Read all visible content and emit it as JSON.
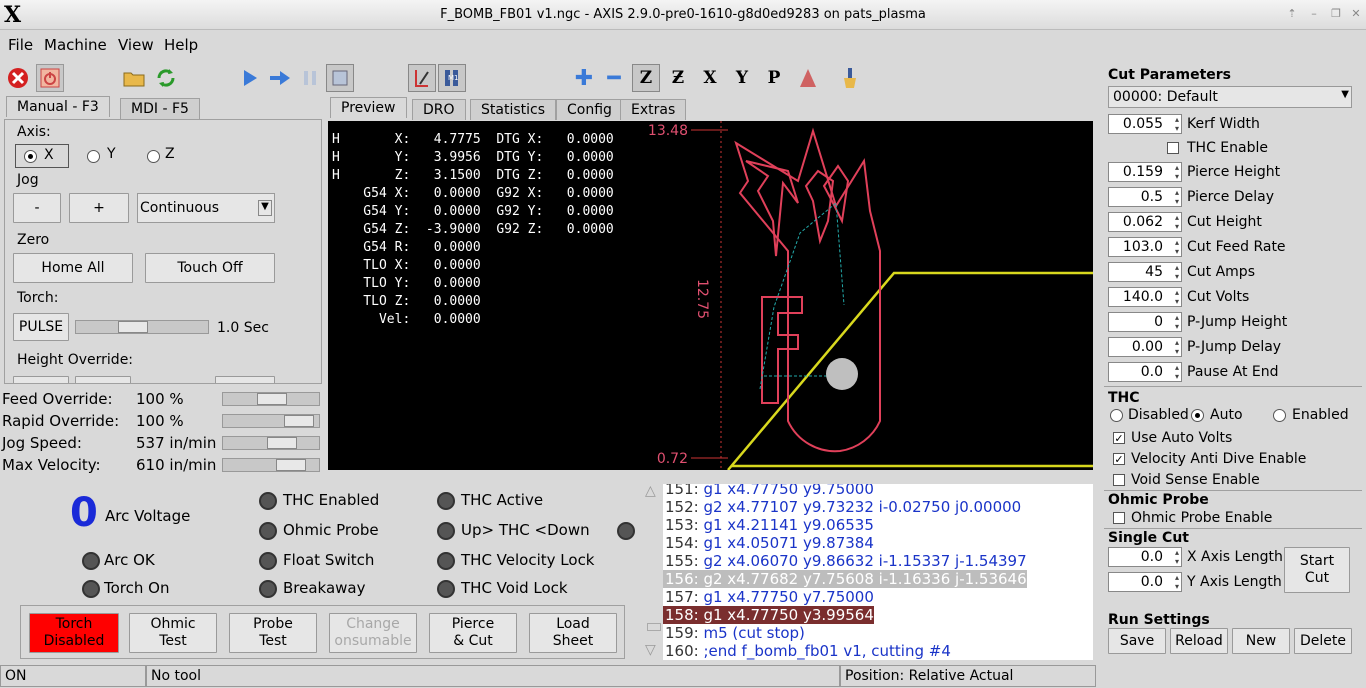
{
  "window": {
    "title": "F_BOMB_FB01 v1.ngc - AXIS 2.9.0-pre0-1610-g8d0ed9283 on pats_plasma",
    "logo": "X"
  },
  "menu": {
    "file": "File",
    "machine": "Machine",
    "view": "View",
    "help": "Help"
  },
  "left_tabs": {
    "manual": "Manual - F3",
    "mdi": "MDI - F5"
  },
  "manual": {
    "axis_label": "Axis:",
    "axis_x": "X",
    "axis_y": "Y",
    "axis_z": "Z",
    "jog_label": "Jog",
    "jog_minus": "-",
    "jog_plus": "+",
    "jog_mode": "Continuous",
    "zero_label": "Zero",
    "home_all": "Home All",
    "touch_off": "Touch Off",
    "torch_label": "Torch:",
    "pulse": "PULSE",
    "pulse_time": "1.0 Sec",
    "height_override": "Height Override:"
  },
  "overrides": [
    {
      "label": "Feed Override:",
      "value": "100 %",
      "level": 0.5
    },
    {
      "label": "Rapid Override:",
      "value": "100 %",
      "level": 0.9
    },
    {
      "label": "Jog Speed:",
      "value": "537 in/min",
      "level": 0.65
    },
    {
      "label": "Max Velocity:",
      "value": "610 in/min",
      "level": 0.78
    }
  ],
  "view_tabs": {
    "preview": "Preview",
    "dro": "DRO",
    "statistics": "Statistics",
    "config": "Config",
    "extras": "Extras"
  },
  "dro_lines": [
    "H       X:   4.7775  DTG X:   0.0000",
    "H       Y:   3.9956  DTG Y:   0.0000",
    "H       Z:   3.1500  DTG Z:   0.0000",
    "    G54 X:   0.0000  G92 X:   0.0000",
    "    G54 Y:   0.0000  G92 Y:   0.0000",
    "    G54 Z:  -3.9000  G92 Z:   0.0000",
    "    G54 R:   0.0000",
    "    TLO X:   0.0000",
    "    TLO Y:   0.0000",
    "    TLO Z:   0.0000",
    "      Vel:   0.0000"
  ],
  "preview": {
    "z_top": "13.48",
    "z_mid": "12.75",
    "z_bottom": "0.72"
  },
  "status": {
    "arc_voltage_value": "0",
    "arc_voltage": "Arc Voltage",
    "arc_ok": "Arc OK",
    "torch_on": "Torch On",
    "thc_enabled": "THC Enabled",
    "ohmic_probe": "Ohmic Probe",
    "float_switch": "Float Switch",
    "breakaway": "Breakaway",
    "thc_active": "THC Active",
    "up_down": "Up> THC <Down",
    "thc_velocity_lock": "THC Velocity Lock",
    "thc_void_lock": "THC Void Lock"
  },
  "buttons": {
    "torch_disabled": "Torch\nDisabled",
    "ohmic_test": "Ohmic\nTest",
    "probe_test": "Probe\nTest",
    "change_consumable": "Change\nonsumable",
    "pierce_cut": "Pierce\n& Cut",
    "load_sheet": "Load\nSheet"
  },
  "gcode": [
    {
      "n": "151:",
      "code": "g1 x4.77750 y9.75000",
      "hl": ""
    },
    {
      "n": "152:",
      "code": "g2 x4.77107 y9.73232 i-0.02750 j0.00000",
      "hl": ""
    },
    {
      "n": "153:",
      "code": "g1 x4.21141 y9.06535",
      "hl": ""
    },
    {
      "n": "154:",
      "code": "g1 x4.05071 y9.87384",
      "hl": ""
    },
    {
      "n": "155:",
      "code": "g2 x4.06070 y9.86632 i-1.15337 j-1.54397",
      "hl": ""
    },
    {
      "n": "156:",
      "code": "g2 x4.77682 y7.75608 i-1.16336 j-1.53646",
      "hl": "gray"
    },
    {
      "n": "157:",
      "code": "g1 x4.77750 y7.75000",
      "hl": ""
    },
    {
      "n": "158:",
      "code": "g1 x4.77750 y3.99564",
      "hl": "red"
    },
    {
      "n": "159:",
      "code": "m5 (cut stop)",
      "hl": ""
    },
    {
      "n": "160:",
      "code": ";end f_bomb_fb01 v1, cutting #4",
      "hl": ""
    }
  ],
  "cut_params": {
    "title": "Cut Parameters",
    "material": "00000: Default",
    "thc_enable": "THC Enable",
    "rows": [
      {
        "value": "0.055",
        "label": "Kerf Width"
      },
      {
        "value": "0.159",
        "label": "Pierce Height"
      },
      {
        "value": "0.5",
        "label": "Pierce Delay"
      },
      {
        "value": "0.062",
        "label": "Cut Height"
      },
      {
        "value": "103.0",
        "label": "Cut Feed Rate"
      },
      {
        "value": "45",
        "label": "Cut Amps"
      },
      {
        "value": "140.0",
        "label": "Cut Volts"
      },
      {
        "value": "0",
        "label": "P-Jump Height"
      },
      {
        "value": "0.00",
        "label": "P-Jump Delay"
      },
      {
        "value": "0.0",
        "label": "Pause At End"
      }
    ]
  },
  "thc": {
    "title": "THC",
    "disabled": "Disabled",
    "auto": "Auto",
    "enabled": "Enabled",
    "use_auto_volts": "Use Auto Volts",
    "velocity_anti_dive": "Velocity Anti Dive Enable",
    "void_sense": "Void Sense Enable"
  },
  "ohmic": {
    "title": "Ohmic Probe",
    "enable": "Ohmic Probe Enable"
  },
  "single_cut": {
    "title": "Single Cut",
    "x_value": "0.0",
    "x_label": "X Axis Length",
    "y_value": "0.0",
    "y_label": "Y Axis Length",
    "start": "Start\nCut"
  },
  "run_settings": {
    "title": "Run Settings",
    "save": "Save",
    "reload": "Reload",
    "new": "New",
    "delete": "Delete"
  },
  "statusbar": {
    "state": "ON",
    "tool": "No tool",
    "position": "Position: Relative Actual"
  },
  "colors": {
    "torch_disabled_bg": "#ff0000",
    "gcode_text": "#1a34c8",
    "highlight_red": "#7a2e2e",
    "highlight_gray": "#bdbdbd",
    "part_outline": "#e0405a",
    "toolpath": "#d8d81e"
  }
}
